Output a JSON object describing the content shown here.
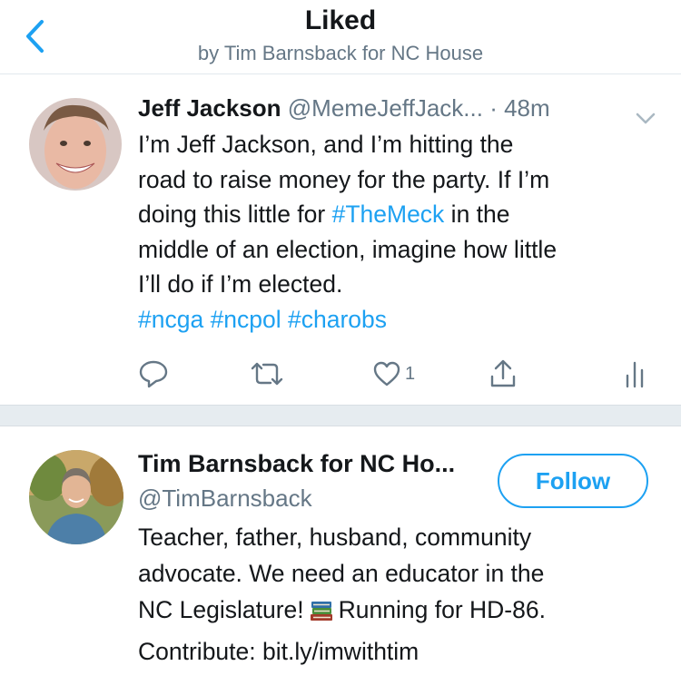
{
  "header": {
    "title": "Liked",
    "subtitle": "by Tim Barnsback for NC House"
  },
  "tweet": {
    "author_name": "Jeff Jackson",
    "author_handle": "@MemeJeffJack...",
    "time": "· 48m",
    "text": {
      "line1": "I’m Jeff Jackson, and I’m hitting the",
      "line2": "road to raise money for the party. If I’m",
      "line3_pre": "doing this little for ",
      "line3_tag": "#TheMeck",
      "line3_post": " in the",
      "line4": "middle of an election, imagine how little",
      "line5": "I’ll do if I’m elected.",
      "hashtags": "#ncga #ncpol #charobs"
    },
    "like_count": "1",
    "icons": [
      "reply-icon",
      "retweet-icon",
      "like-icon",
      "share-icon",
      "analytics-icon",
      "chevron-down-icon"
    ]
  },
  "user_card": {
    "name": "Tim Barnsback for NC Ho...",
    "handle": "@TimBarnsback",
    "follow_label": "Follow",
    "bio": {
      "line1": "Teacher, father, husband, community",
      "line2": "advocate. We need an educator in the",
      "line3_pre": "NC Legislature!",
      "line3_post": "Running for HD-86.",
      "line4": "Contribute: bit.ly/imwithtim"
    }
  },
  "colors": {
    "accent": "#1da1f2",
    "secondary_text": "#657786",
    "primary_text": "#14171a",
    "separator": "#e6ecf0"
  }
}
